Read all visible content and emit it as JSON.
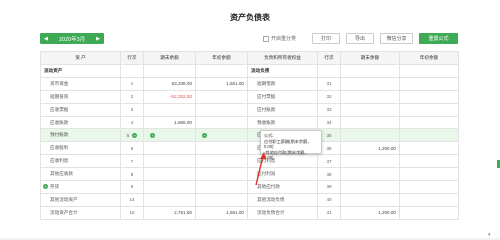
{
  "page": {
    "title": "资产负债表"
  },
  "toolbar": {
    "period": "2020年3月",
    "prev_icon": "triangle-left-icon",
    "next_icon": "triangle-right-icon",
    "checkbox_label": "开启重分类",
    "print_label": "打印",
    "export_label": "导出",
    "share_label": "微信分享",
    "formula_label": "重置公式"
  },
  "table": {
    "headers": [
      "资 产",
      "行次",
      "期末余额",
      "年初余额",
      "负债和所有者权益",
      "行次",
      "期末余额",
      "年初余额"
    ],
    "rows": [
      {
        "l_name": "流动资产",
        "l_line": "",
        "l_end": "",
        "l_begin": "",
        "r_name": "流动负债",
        "r_line": "",
        "r_end": "",
        "r_begin": ""
      },
      {
        "l_name": "货币资金",
        "l_line": "1",
        "l_end": "53,338.00",
        "l_begin": "1,551.00",
        "r_name": "短期借款",
        "r_line": "31",
        "r_end": "",
        "r_begin": ""
      },
      {
        "l_name": "短期投资",
        "l_line": "2",
        "l_end": "-52,252.00",
        "l_begin": "",
        "r_name": "应付票据",
        "r_line": "32",
        "r_end": "",
        "r_begin": ""
      },
      {
        "l_name": "应收票据",
        "l_line": "3",
        "l_end": "",
        "l_begin": "",
        "r_name": "应付账款",
        "r_line": "33",
        "r_end": "",
        "r_begin": ""
      },
      {
        "l_name": "应收账款",
        "l_line": "4",
        "l_end": "1,665.00",
        "l_begin": "",
        "r_name": "预收账款",
        "r_line": "34",
        "r_end": "",
        "r_begin": ""
      },
      {
        "l_name": "预付账款",
        "l_line": "5",
        "l_end": "",
        "l_begin": "",
        "r_name": "应付职工薪酬",
        "r_line": "35",
        "r_end": "",
        "r_begin": ""
      },
      {
        "l_name": "应收股利",
        "l_line": "6",
        "l_end": "",
        "l_begin": "",
        "r_name": "应交税费",
        "r_line": "36",
        "r_end": "1,200.00",
        "r_begin": ""
      },
      {
        "l_name": "应收利息",
        "l_line": "7",
        "l_end": "",
        "l_begin": "",
        "r_name": "应付利息",
        "r_line": "37",
        "r_end": "",
        "r_begin": ""
      },
      {
        "l_name": "其他应收款",
        "l_line": "8",
        "l_end": "",
        "l_begin": "",
        "r_name": "应付利润",
        "r_line": "38",
        "r_end": "",
        "r_begin": ""
      },
      {
        "l_name": "存货",
        "l_line": "9",
        "l_end": "",
        "l_begin": "",
        "r_name": "其他应付款",
        "r_line": "39",
        "r_end": "",
        "r_begin": ""
      },
      {
        "l_name": "其他流动资产",
        "l_line": "14",
        "l_end": "",
        "l_begin": "",
        "r_name": "其他流动负债",
        "r_line": "40",
        "r_end": "",
        "r_begin": ""
      },
      {
        "l_name": "流动资产合计",
        "l_line": "15",
        "l_end": "2,751.00",
        "l_begin": "1,551.00",
        "r_name": "流动负债合计",
        "r_line": "41",
        "r_end": "1,200.00",
        "r_begin": ""
      }
    ]
  },
  "tooltip": {
    "line1": "公式:",
    "line2": "应付职工薪酬(期末余额，0.00)",
    "line3": "-其他应付款(期末余额，0.00)"
  },
  "colors": {
    "accent": "#3eaa56",
    "negative": "#e05050",
    "highlight_row": "#e9f6ea",
    "annotation_arrow": "#d9352b"
  }
}
